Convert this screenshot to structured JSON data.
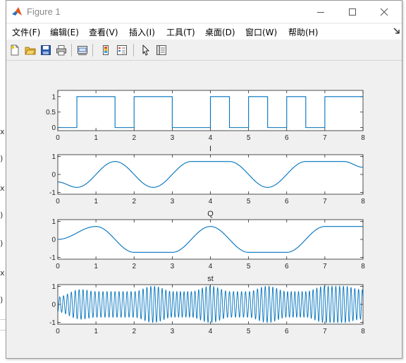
{
  "window": {
    "title": "Figure 1",
    "controls": [
      "minimize",
      "maximize",
      "close"
    ]
  },
  "menubar": {
    "items": [
      {
        "label": "文件(F)"
      },
      {
        "label": "编辑(E)"
      },
      {
        "label": "查看(V)"
      },
      {
        "label": "插入(I)"
      },
      {
        "label": "工具(T)"
      },
      {
        "label": "桌面(D)"
      },
      {
        "label": "窗口(W)"
      },
      {
        "label": "帮助(H)"
      }
    ]
  },
  "toolbar": {
    "icons": [
      "new-figure-icon",
      "open-file-icon",
      "save-icon",
      "print-icon",
      "link-plot-icon",
      "insert-colorbar-icon",
      "insert-legend-icon",
      "edit-plot-icon",
      "property-inspector-icon"
    ]
  },
  "background_edge_glyphs": [
    "x",
    ")",
    "x",
    ")",
    ")",
    "x",
    ")"
  ],
  "colors": {
    "line": "#0072bd",
    "axes_bg": "#ffffff",
    "figure_bg": "#f0f0f0",
    "title_text": "#8a8a8a"
  },
  "chart_data": [
    {
      "type": "line",
      "title": "",
      "xlabel": "",
      "ylabel": "",
      "xlim": [
        0,
        8
      ],
      "ylim": [
        -0.1,
        1.2
      ],
      "xticks": [
        0,
        1,
        2,
        3,
        4,
        5,
        6,
        7,
        8
      ],
      "yticks": [
        0,
        0.5,
        1
      ],
      "ytick_labels": [
        "0",
        "0.5",
        "1"
      ],
      "kind": "step",
      "bits": [
        0,
        1,
        1,
        0,
        1,
        1,
        0,
        0,
        1,
        0,
        1,
        0,
        1,
        0,
        1,
        1
      ],
      "bit_duration": 0.5
    },
    {
      "type": "line",
      "title": "I",
      "xlabel": "",
      "ylabel": "",
      "xlim": [
        0,
        8
      ],
      "ylim": [
        -1.1,
        1.1
      ],
      "xticks": [
        0,
        1,
        2,
        3,
        4,
        5,
        6,
        7,
        8
      ],
      "yticks": [
        -1,
        0,
        1
      ],
      "ytick_labels": [
        "-1",
        "0",
        "1"
      ],
      "x": [
        0,
        0.5,
        1.5,
        2.5,
        3.5,
        4.5,
        5.5,
        6.5,
        7.5,
        8
      ],
      "y": [
        -0.42,
        -0.72,
        0.72,
        -0.72,
        0.72,
        0.72,
        -0.72,
        0.72,
        0.72,
        0.4
      ]
    },
    {
      "type": "line",
      "title": "Q",
      "xlabel": "",
      "ylabel": "",
      "xlim": [
        0,
        8
      ],
      "ylim": [
        -1.1,
        1.1
      ],
      "xticks": [
        0,
        1,
        2,
        3,
        4,
        5,
        6,
        7,
        8
      ],
      "yticks": [
        -1,
        0,
        1
      ],
      "ytick_labels": [
        "-1",
        "0",
        "1"
      ],
      "x": [
        0,
        1,
        2,
        3,
        4,
        5,
        6,
        7,
        8
      ],
      "y": [
        0.0,
        0.72,
        -0.72,
        -0.72,
        0.72,
        -0.72,
        -0.72,
        0.72,
        0.72
      ]
    },
    {
      "type": "line",
      "title": "st",
      "xlabel": "",
      "ylabel": "",
      "xlim": [
        0,
        8
      ],
      "ylim": [
        -1.1,
        1.1
      ],
      "xticks": [
        0,
        1,
        2,
        3,
        4,
        5,
        6,
        7,
        8
      ],
      "yticks": [
        -1,
        0,
        1
      ],
      "ytick_labels": [
        "-1",
        "0",
        "1"
      ],
      "kind": "modulated",
      "carrier_cycles_per_unit": 10
    }
  ]
}
